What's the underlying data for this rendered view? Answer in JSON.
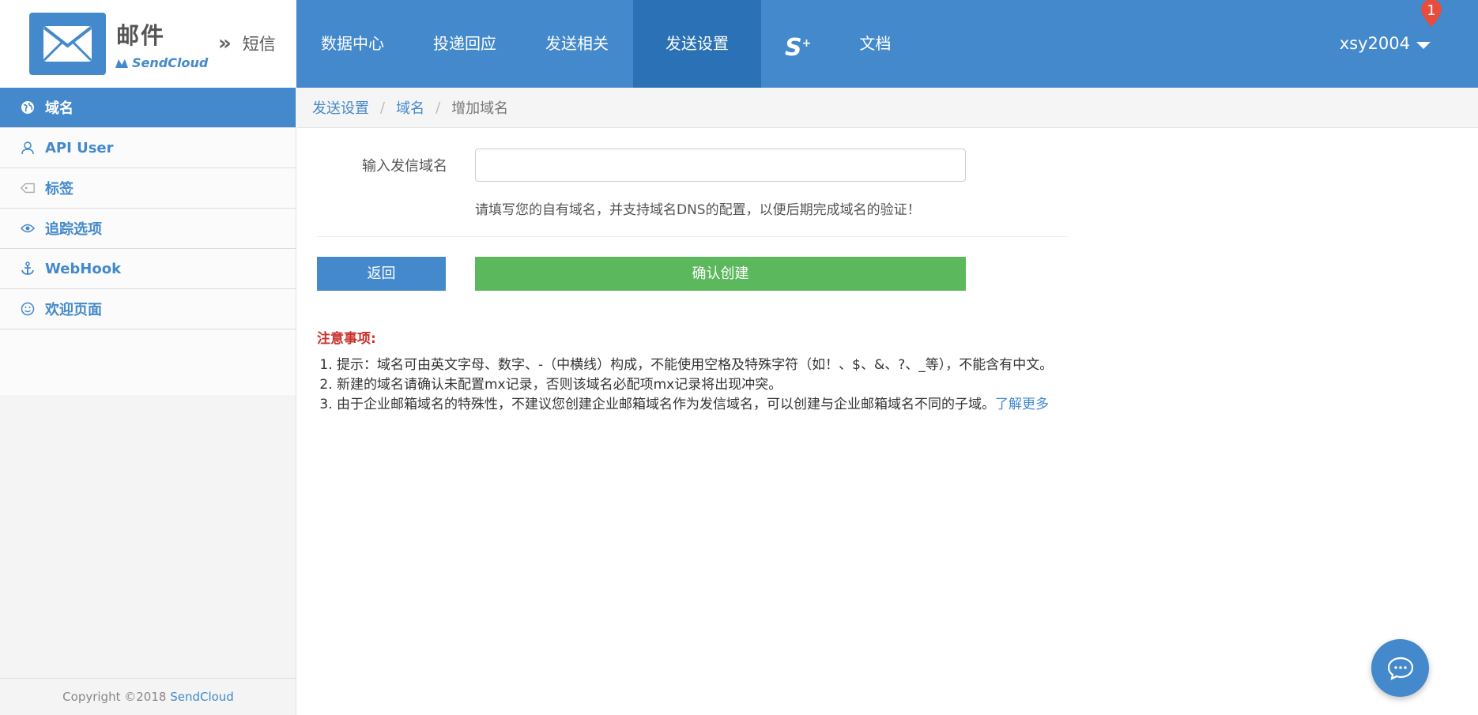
{
  "brand": {
    "title": "邮件",
    "subtitle": "SendCloud",
    "switch_label": "短信"
  },
  "nav": {
    "items": [
      {
        "label": "数据中心"
      },
      {
        "label": "投递回应"
      },
      {
        "label": "发送相关"
      },
      {
        "label": "发送设置"
      },
      {
        "label": "S"
      },
      {
        "label": "文档"
      }
    ],
    "active": "发送设置",
    "splus_sup": "+"
  },
  "user": {
    "name": "xsy2004",
    "notification_count": "1"
  },
  "sidebar": {
    "items": [
      {
        "label": "域名",
        "icon": "globe-icon"
      },
      {
        "label": "API User",
        "icon": "user-icon"
      },
      {
        "label": "标签",
        "icon": "tag-icon"
      },
      {
        "label": "追踪选项",
        "icon": "eye-icon"
      },
      {
        "label": "WebHook",
        "icon": "anchor-icon"
      },
      {
        "label": "欢迎页面",
        "icon": "smile-icon"
      }
    ],
    "active": "域名",
    "copyright_prefix": "Copyright ©2018 ",
    "copyright_link": "SendCloud"
  },
  "breadcrumb": {
    "items": [
      "发送设置",
      "域名",
      "增加域名"
    ],
    "separator": "/"
  },
  "form": {
    "label": "输入发信域名",
    "input_value": "",
    "input_placeholder": "",
    "help": "请填写您的自有域名，并支持域名DNS的配置，以便后期完成域名的验证！",
    "back_label": "返回",
    "create_label": "确认创建"
  },
  "notes": {
    "title": "注意事项:",
    "items": [
      "提示：域名可由英文字母、数字、-（中横线）构成，不能使用空格及特殊字符（如！、$、&、?、_等），不能含有中文。",
      "新建的域名请确认未配置mx记录，否则该域名必配项mx记录将出现冲突。",
      "由于企业邮箱域名的特殊性，不建议您创建企业邮箱域名作为发信域名，可以创建与企业邮箱域名不同的子域。"
    ],
    "more_link": "了解更多"
  },
  "colors": {
    "primary": "#4389cb",
    "primary_dark": "#2a71b5",
    "success": "#5cb85c",
    "danger": "#c9302c",
    "badge": "#e74c3c"
  },
  "chat": {
    "icon": "chat-icon"
  }
}
